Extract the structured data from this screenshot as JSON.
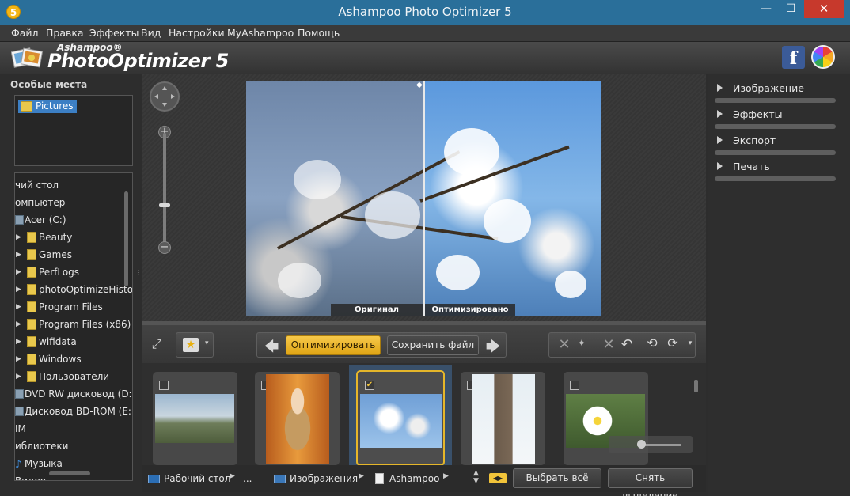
{
  "window": {
    "title": "Ashampoo Photo Optimizer 5",
    "app_icon_glyph": "5",
    "minimize_glyph": "—",
    "maximize_glyph": "☐",
    "close_glyph": "✕"
  },
  "menu": [
    "Файл",
    "Правка",
    "Эффекты",
    "Вид",
    "Настройки",
    "MyAshampoo",
    "Помощь"
  ],
  "logo": {
    "brand_small": "Ashampoo®",
    "brand_big": "PhotoOptimizer 5",
    "facebook_glyph": "f"
  },
  "left": {
    "places_header": "Особые места",
    "places_item": "Pictures",
    "tree": [
      {
        "label": "чий стол",
        "type": "plain",
        "indent": 0
      },
      {
        "label": "омпьютер",
        "type": "plain",
        "indent": 0
      },
      {
        "label": "Acer (C:)",
        "type": "drive",
        "indent": 0
      },
      {
        "label": "Beauty",
        "type": "folder",
        "indent": 1
      },
      {
        "label": "Games",
        "type": "folder",
        "indent": 1
      },
      {
        "label": "PerfLogs",
        "type": "folder",
        "indent": 1
      },
      {
        "label": "photoOptimizeHistory",
        "type": "folder",
        "indent": 1
      },
      {
        "label": "Program Files",
        "type": "folder",
        "indent": 1
      },
      {
        "label": "Program Files (x86)",
        "type": "folder",
        "indent": 1
      },
      {
        "label": "wifidata",
        "type": "folder",
        "indent": 1
      },
      {
        "label": "Windows",
        "type": "folder",
        "indent": 1
      },
      {
        "label": "Пользователи",
        "type": "folder",
        "indent": 1
      },
      {
        "label": "DVD RW дисковод (D:)",
        "type": "drive",
        "indent": 0
      },
      {
        "label": "Дисковод BD-ROM (E:)",
        "type": "drive",
        "indent": 0
      },
      {
        "label": "IM",
        "type": "plain",
        "indent": 0
      },
      {
        "label": "иблиотеки",
        "type": "plain",
        "indent": 0
      },
      {
        "label": "Музыка",
        "type": "music",
        "indent": 0
      },
      {
        "label": "Видео",
        "type": "plain",
        "indent": 0
      }
    ]
  },
  "viewer": {
    "label_original": "Оригинал",
    "label_optimized": "Оптимизировано",
    "zoom_plus": "+",
    "zoom_minus": "−",
    "zoom_level": 0.35
  },
  "toolbar": {
    "optimize": "Оптимизировать",
    "save": "Сохранить файл",
    "prev": "🡄",
    "next": "🡆"
  },
  "thumbnails": [
    {
      "checked": false,
      "selected": false,
      "check_glyph": ""
    },
    {
      "checked": false,
      "selected": false,
      "check_glyph": ""
    },
    {
      "checked": true,
      "selected": true,
      "check_glyph": "✔"
    },
    {
      "checked": false,
      "selected": false,
      "check_glyph": ""
    },
    {
      "checked": false,
      "selected": false,
      "check_glyph": ""
    }
  ],
  "status": {
    "crumb_desktop": "Рабочий стол",
    "crumb_ellipsis": "...",
    "crumb_images": "Изображения",
    "crumb_ashampoo": "Ashampoo",
    "select_all": "Выбрать всё",
    "deselect": "Снять выделение"
  },
  "right": {
    "items": [
      "Изображение",
      "Эффекты",
      "Экспорт",
      "Печать"
    ]
  }
}
